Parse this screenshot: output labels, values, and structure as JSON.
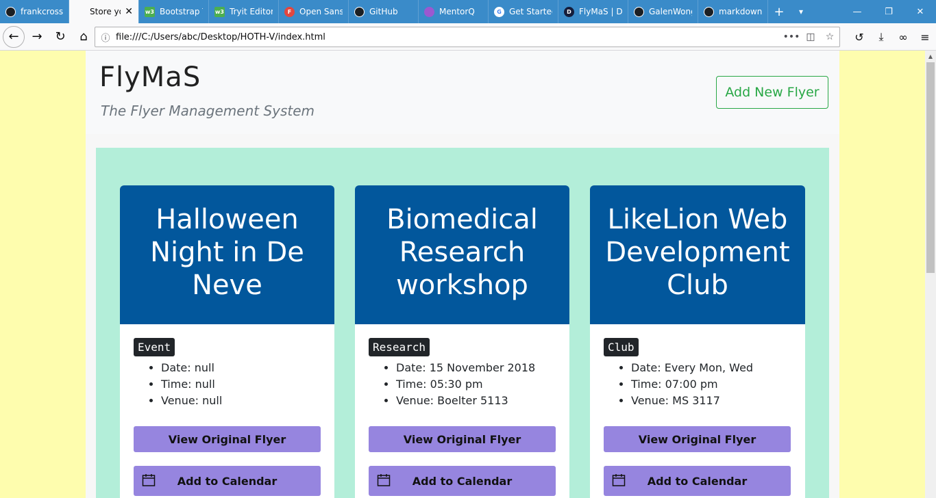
{
  "browser": {
    "tabs": [
      {
        "label": "frankcrossin",
        "icon": "github-icon"
      },
      {
        "label": "Store yo",
        "icon": "none",
        "active": true
      },
      {
        "label": "Bootstrap T",
        "icon": "w3schools-icon"
      },
      {
        "label": "Tryit Editor",
        "icon": "w3schools-icon"
      },
      {
        "label": "Open Sans",
        "icon": "font-icon"
      },
      {
        "label": "GitHub",
        "icon": "github-icon"
      },
      {
        "label": "MentorQ",
        "icon": "mentorq-icon"
      },
      {
        "label": "Get Started",
        "icon": "google-icon"
      },
      {
        "label": "FlyMaS | De",
        "icon": "devpost-icon"
      },
      {
        "label": "GalenWong",
        "icon": "github-icon"
      },
      {
        "label": "markdown",
        "icon": "github-icon"
      }
    ],
    "url": "file:///C:/Users/abc/Desktop/HOTH-V/index.html"
  },
  "header": {
    "brand": "FlyMaS",
    "tagline": "The Flyer Management System",
    "add_label": "Add New Flyer"
  },
  "cards": [
    {
      "title": "Halloween Night in De Neve",
      "category": "Event",
      "details": [
        "Date: null",
        "Time: null",
        "Venue: null"
      ],
      "view_label": "View Original Flyer",
      "calendar_label": "Add to Calendar"
    },
    {
      "title": "Biomedical Research workshop",
      "category": "Research",
      "details": [
        "Date: 15 November 2018",
        "Time: 05:30 pm",
        "Venue: Boelter 5113"
      ],
      "view_label": "View Original Flyer",
      "calendar_label": "Add to Calendar"
    },
    {
      "title": "LikeLion Web Development Club",
      "category": "Club",
      "details": [
        "Date: Every Mon, Wed",
        "Time: 07:00 pm",
        "Venue: MS 3117"
      ],
      "view_label": "View Original Flyer",
      "calendar_label": "Add to Calendar"
    }
  ],
  "colors": {
    "page_bg": "#fefdae",
    "board_bg": "#b3eed9",
    "card_head": "#02579c",
    "button": "#9685df",
    "add_button": "#28a745",
    "tab_bar": "#3a8bc9"
  }
}
